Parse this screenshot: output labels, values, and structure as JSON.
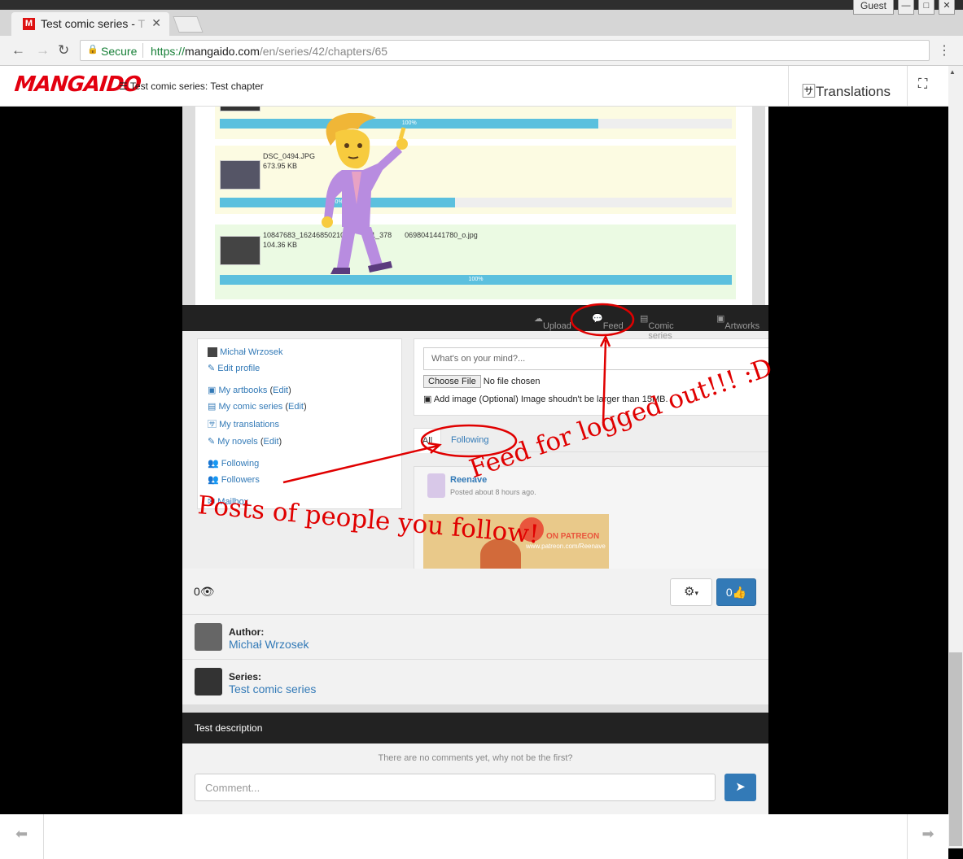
{
  "browser": {
    "tab_title": "Test comic series - ",
    "tab_title_faded": "T",
    "tab_favicon": "M",
    "guest_label": "Guest",
    "secure_label": "Secure",
    "url_scheme": "https://",
    "url_domain": "mangaido.com",
    "url_path": "/en/series/42/chapters/65"
  },
  "site": {
    "logo": "MANGAIDO",
    "breadcrumb": "Test comic series: Test chapter",
    "translations_label": "Translations"
  },
  "comic": {
    "uploads": [
      {
        "name": "",
        "size": "",
        "progress_label": "100%",
        "progress": 0.74
      },
      {
        "name": "DSC_0494.JPG",
        "size": "673.95 KB",
        "progress_label": "90%",
        "progress": 0.46
      },
      {
        "name": "10847683_162468502109",
        "name_end": "1_378",
        "name_tail": "0698041441780_o.jpg",
        "size": "104.36 KB",
        "progress_label": "100%",
        "progress": 1.0
      }
    ],
    "nav": {
      "upload": "Upload",
      "feed": "Feed",
      "comic_series": "Comic series",
      "artworks": "Artworks"
    },
    "sidebar": {
      "user": "Michał Wrzosek",
      "edit_profile": "Edit profile",
      "my_artbooks": "My artbooks",
      "my_comic_series": "My comic series",
      "my_translations": "My translations",
      "my_novels": "My novels",
      "edit": "Edit",
      "following": "Following",
      "followers": "Followers",
      "mailbox": "Mailbox"
    },
    "composer": {
      "placeholder": "What's on your mind?...",
      "choose_file": "Choose File",
      "no_file": "No file chosen",
      "add_image": "Add image (Optional) Image shoudn't be larger than 15MB."
    },
    "feed_tabs": {
      "all": "All",
      "following": "Following"
    },
    "post": {
      "author": "Reenave",
      "time": "Posted about 8 hours ago.",
      "banner_text": "ON PATREON",
      "banner_url": "www.patreon.com/Reenave"
    },
    "annotations": {
      "feed_note": "Feed for logged out!!! :D",
      "following_note": "Posts of people you follow!"
    }
  },
  "post_footer": {
    "views": "0",
    "likes": "0",
    "author_label": "Author:",
    "author_name": "Michał Wrzosek",
    "series_label": "Series:",
    "series_name": "Test comic series",
    "description": "Test description",
    "no_comments": "There are no comments yet, why not be the first?",
    "comment_placeholder": "Comment..."
  },
  "colors": {
    "brand": "#e3000f",
    "link": "#337ab7",
    "progress": "#5bc0de",
    "annotation": "#e00000"
  }
}
